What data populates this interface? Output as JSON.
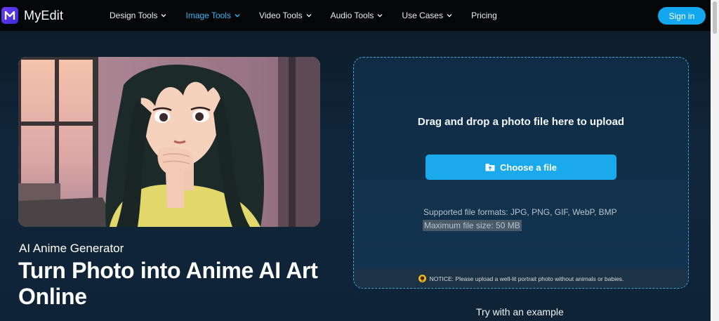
{
  "brand": {
    "name": "MyEdit",
    "logo_letter": "M"
  },
  "nav": {
    "items": [
      {
        "label": "Design Tools",
        "has_menu": true,
        "active": false
      },
      {
        "label": "Image Tools",
        "has_menu": true,
        "active": true
      },
      {
        "label": "Video Tools",
        "has_menu": true,
        "active": false
      },
      {
        "label": "Audio Tools",
        "has_menu": true,
        "active": false
      },
      {
        "label": "Use Cases",
        "has_menu": true,
        "active": false
      },
      {
        "label": "Pricing",
        "has_menu": false,
        "active": false
      }
    ],
    "signin_label": "Sign in"
  },
  "hero": {
    "subtitle": "AI Anime Generator",
    "title": "Turn Photo into Anime AI Art Online"
  },
  "upload": {
    "drag_text": "Drag and drop a photo file here to upload",
    "choose_label": "Choose a file",
    "formats_text": "Supported file formats: JPG, PNG, GIF, WebP, BMP",
    "maxsize_text": "Maximum file size: 50 MB",
    "notice_text": "NOTICE: Please upload a well-lit portrait photo without animals or babies."
  },
  "examples": {
    "heading": "Try with an example"
  },
  "colors": {
    "accent": "#12a7ee",
    "active_nav": "#37b6f6",
    "background": "#0f2337",
    "header": "#050608"
  }
}
